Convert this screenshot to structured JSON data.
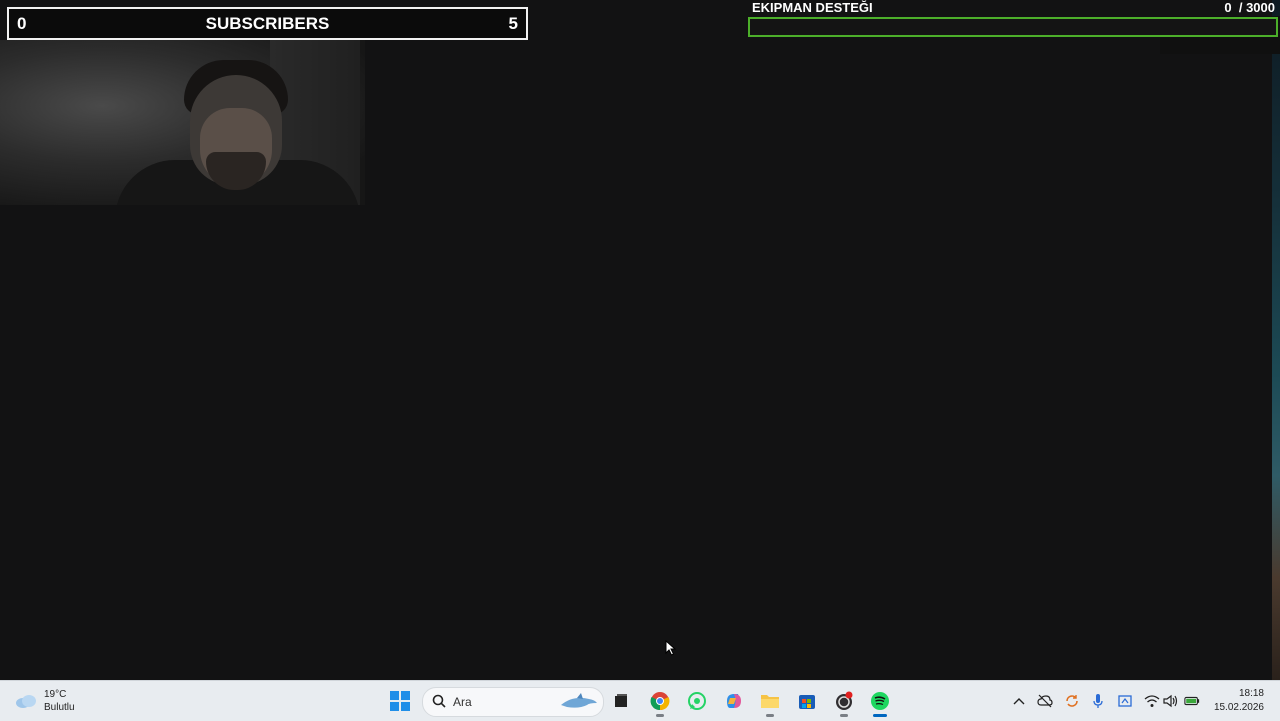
{
  "overlay": {
    "subscribers": {
      "left_count": "0",
      "label": "SUBSCRIBERS",
      "right_count": "5"
    },
    "goal": {
      "title": "EKIPMAN DESTEĞI",
      "current": "0",
      "target": "/ 3000",
      "progress_fraction": 0.0,
      "bar_color": "#4caf2a"
    }
  },
  "window_controls": {
    "minimize": "─",
    "maximize": "☐",
    "close": "✕"
  },
  "taskbar": {
    "weather": {
      "temp": "19°C",
      "condition": "Bulutlu"
    },
    "search": {
      "placeholder": "Ara"
    },
    "apps": [
      {
        "name": "start-icon"
      },
      {
        "name": "task-view-icon"
      },
      {
        "name": "chrome-icon"
      },
      {
        "name": "whatsapp-icon"
      },
      {
        "name": "copilot-icon"
      },
      {
        "name": "file-explorer-icon"
      },
      {
        "name": "microsoft-store-icon"
      },
      {
        "name": "obs-icon"
      },
      {
        "name": "spotify-icon"
      }
    ],
    "clock": {
      "time": "18:18",
      "date": "15.02.2026"
    }
  }
}
